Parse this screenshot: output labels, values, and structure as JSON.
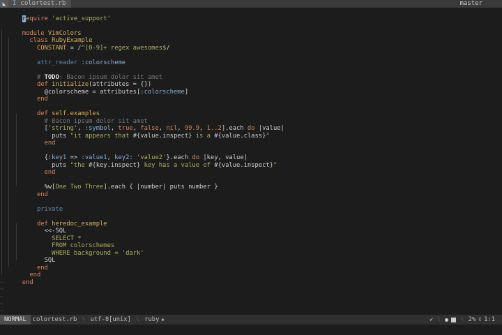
{
  "tabline": {
    "icon": "vim-icon",
    "tab_marker": "I",
    "tab_label": "colortest.rb",
    "branch": "master"
  },
  "code": {
    "l1_kw": "require",
    "l1_rest": " 'active_support'",
    "l1_cursor": "r",
    "l1_after": "equire",
    "l3_kw": "module",
    "l3_name": " VimColors",
    "l4_kw": "class",
    "l4_name": " RubyExample",
    "l5_const": "CONSTANT",
    "l5_op": " = /",
    "l5_regex": "^[0-9]+ regex awesomes$",
    "l5_end": "/",
    "l7_a": "attr_reader",
    "l7_b": " :colorscheme",
    "l9_cmt": "# ",
    "l9_todo": "TODO",
    "l9_rest": ": Bacon ipsum dolor sit amet",
    "l10_def": "def",
    "l10_name": " initialize",
    "l10_rest": "(attributes = {})",
    "l11_ivar": "@colorscheme",
    "l11_rest": " = attributes[",
    "l11_sym": ":colorscheme",
    "l11_end": "]",
    "l12_end": "end",
    "l14_def": "def",
    "l14_name": " self.examples",
    "l15_cmt": "# Bacon ipsum dolor sit amet",
    "l16_a": "[",
    "l16_b": "'string'",
    "l16_c": ", ",
    "l16_d": ":symbol",
    "l16_e": ", ",
    "l16_f": "true",
    "l16_g": ", ",
    "l16_h": "false",
    "l16_i": ", ",
    "l16_j": "nil",
    "l16_k": ", ",
    "l16_l": "99.9",
    "l16_m": ", ",
    "l16_n": "1..2",
    "l16_o": "].each ",
    "l16_p": "do",
    "l16_q": " |value|",
    "l17_puts": "puts",
    "l17_s1": " \"it appears that ",
    "l17_i1": "#{value.inspect}",
    "l17_s2": " is a ",
    "l17_i2": "#{value.class}",
    "l17_s3": "\"",
    "l18_end": "end",
    "l20_a": "{",
    "l20_b": ":key1",
    "l20_c": " => ",
    "l20_d": ":value1",
    "l20_e": ", ",
    "l20_f": "key2:",
    "l20_g": " ",
    "l20_h": "'value2'",
    "l20_i": "}.each ",
    "l20_j": "do",
    "l20_k": " |key, value|",
    "l21_puts": "puts",
    "l21_s1": " \"the ",
    "l21_i1": "#{key.inspect}",
    "l21_s2": " key has a value of ",
    "l21_i2": "#{value.inspect}",
    "l21_s3": "\"",
    "l22_end": "end",
    "l24_a": "%w[",
    "l24_b": "One Two Three",
    "l24_c": "]",
    "l24_d": ".each { |number| puts number }",
    "l25_end": "end",
    "l27_priv": "private",
    "l29_def": "def",
    "l29_name": " heredoc_example",
    "l30_a": "<<-SQL",
    "l31_a": "SELECT *",
    "l32_a": "FROM colorschemes",
    "l33_a": "WHERE background = 'dark'",
    "l34_a": "SQL",
    "l35_end": "end",
    "l36_end": "end",
    "l37_end": "end",
    "tilde": "~"
  },
  "statusline": {
    "mode": "NORMAL",
    "file": "colortest.rb",
    "encoding": "utf-8[unix]",
    "filetype": "ruby",
    "percent": "2%",
    "position": "1:1"
  }
}
